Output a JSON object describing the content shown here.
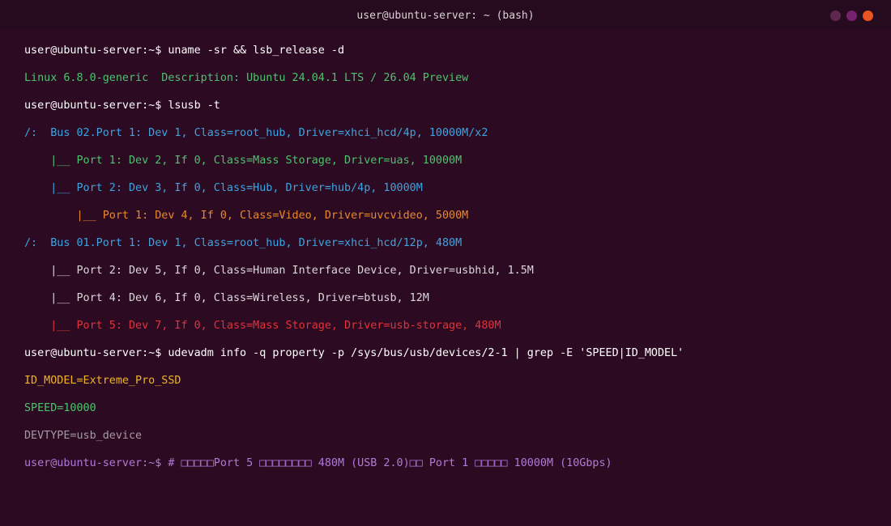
{
  "window": {
    "title": "user@ubuntu-server: ~ (bash)",
    "controls": [
      {
        "name": "minimize",
        "color": "#5e2750"
      },
      {
        "name": "maximize",
        "color": "#77216f"
      },
      {
        "name": "close",
        "color": "#e95420"
      }
    ]
  },
  "colors": {
    "background": "#2c0b22",
    "titlebar": "#260a1d",
    "white": "#ffffff",
    "green": "#4ec26f",
    "blue": "#3ea3e0",
    "orange": "#e8892a",
    "red": "#e0333b",
    "light": "#dcd6da",
    "yellow": "#f0b323",
    "gray": "#a59aa2",
    "purple": "#b07ad8"
  },
  "terminal": {
    "lines": [
      {
        "text": "user@ubuntu-server:~$ uname -sr && lsb_release -d",
        "color": "white"
      },
      {
        "text": "Linux 6.8.0-generic  Description: Ubuntu 24.04.1 LTS / 26.04 Preview",
        "color": "green"
      },
      {
        "text": "user@ubuntu-server:~$ lsusb -t",
        "color": "white"
      },
      {
        "text": "/:  Bus 02.Port 1: Dev 1, Class=root_hub, Driver=xhci_hcd/4p, 10000M/x2",
        "color": "blue"
      },
      {
        "text": "    |__ Port 1: Dev 2, If 0, Class=Mass Storage, Driver=uas, 10000M",
        "color": "green"
      },
      {
        "text": "    |__ Port 2: Dev 3, If 0, Class=Hub, Driver=hub/4p, 10000M",
        "color": "blue"
      },
      {
        "text": "        |__ Port 1: Dev 4, If 0, Class=Video, Driver=uvcvideo, 5000M",
        "color": "orange"
      },
      {
        "text": "/:  Bus 01.Port 1: Dev 1, Class=root_hub, Driver=xhci_hcd/12p, 480M",
        "color": "blue"
      },
      {
        "text": "    |__ Port 2: Dev 5, If 0, Class=Human Interface Device, Driver=usbhid, 1.5M",
        "color": "light"
      },
      {
        "text": "    |__ Port 4: Dev 6, If 0, Class=Wireless, Driver=btusb, 12M",
        "color": "light"
      },
      {
        "text": "    |__ Port 5: Dev 7, If 0, Class=Mass Storage, Driver=usb-storage, 480M",
        "color": "red"
      },
      {
        "text": "user@ubuntu-server:~$ udevadm info -q property -p /sys/bus/usb/devices/2-1 | grep -E 'SPEED|ID_MODEL'",
        "color": "white"
      },
      {
        "text": "ID_MODEL=Extreme_Pro_SSD",
        "color": "yellow"
      },
      {
        "text": "SPEED=10000",
        "color": "green"
      },
      {
        "text": "DEVTYPE=usb_device",
        "color": "gray"
      },
      {
        "text": "user@ubuntu-server:~$ # □□□□□Port 5 □□□□□□□□ 480M (USB 2.0)□□ Port 1 □□□□□ 10000M (10Gbps)",
        "color": "purple"
      }
    ]
  }
}
